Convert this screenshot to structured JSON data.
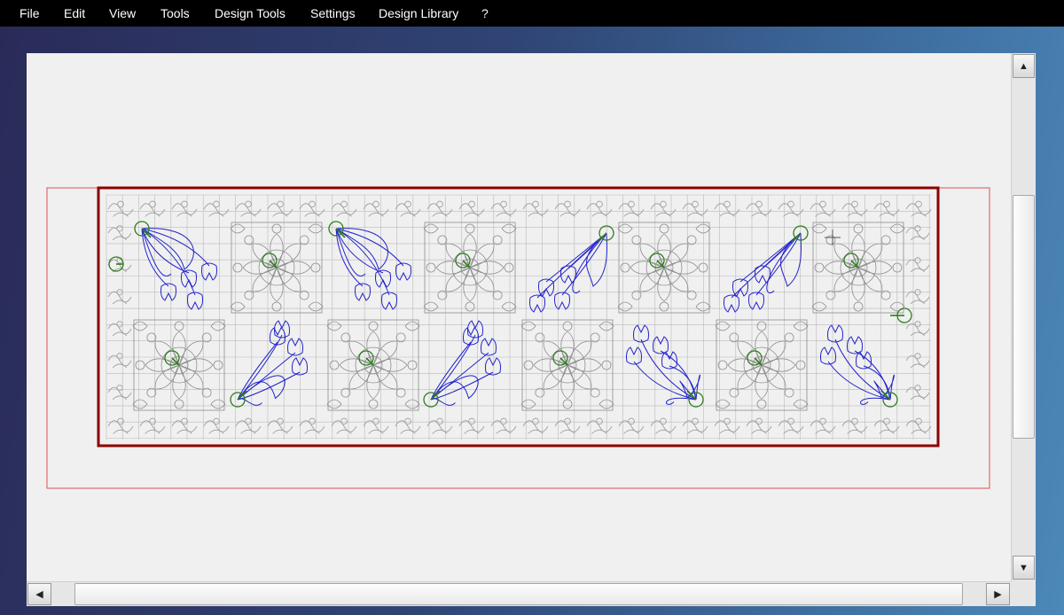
{
  "menu": {
    "items": [
      {
        "label": "File"
      },
      {
        "label": "Edit"
      },
      {
        "label": "View"
      },
      {
        "label": "Tools"
      },
      {
        "label": "Design Tools"
      },
      {
        "label": "Settings"
      },
      {
        "label": "Design Library"
      },
      {
        "label": "?"
      }
    ]
  },
  "scrollbars": {
    "vertical": {
      "up_icon": "arrow-up-icon",
      "down_icon": "arrow-down-icon"
    },
    "horizontal": {
      "left_icon": "arrow-left-icon",
      "right_icon": "arrow-right-icon"
    }
  },
  "layout": {
    "top_row": [
      "tulip",
      "block",
      "tulip",
      "block",
      "tulip",
      "block",
      "tulip",
      "block"
    ],
    "bottom_row": [
      "block",
      "tulip",
      "block",
      "tulip",
      "block",
      "tulip",
      "block",
      "tulip"
    ]
  },
  "colors": {
    "menubar_bg": "#000000",
    "canvas_bg": "#f0f0f0",
    "hoop_outer": "#e05050",
    "quilt_border": "#8b0000",
    "motif_blue": "#2222cc",
    "marker_green": "#2e7d1e",
    "grid_gray": "#b9b9b9"
  }
}
